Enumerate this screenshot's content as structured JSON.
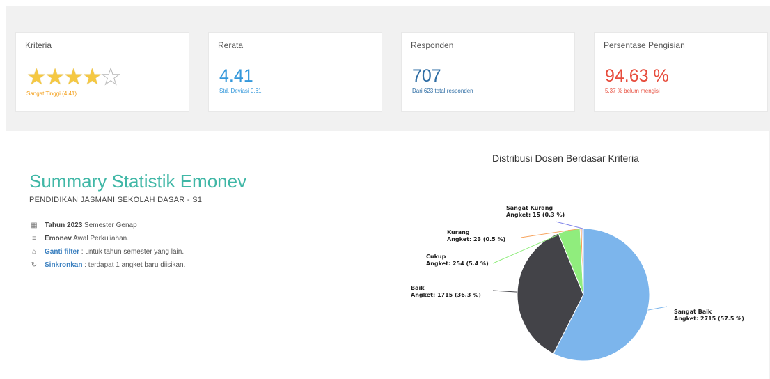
{
  "cards": {
    "kriteria": {
      "title": "Kriteria",
      "rating": 4,
      "rating_max": 5,
      "note": "Sangat Tinggi (4.41)",
      "note_color": "#f39c12"
    },
    "rerata": {
      "title": "Rerata",
      "value": "4.41",
      "note": "Std. Deviasi 0.61",
      "color": "#3498db"
    },
    "responden": {
      "title": "Responden",
      "value": "707",
      "note": "Dari 623 total responden",
      "color": "#2e6da4"
    },
    "persentase": {
      "title": "Persentase Pengisian",
      "value": "94.63 %",
      "note": "5.37 % belum mengisi",
      "color": "#e74c3c"
    }
  },
  "summary": {
    "title": "Summary Statistik Emonev",
    "subtitle": "PENDIDIKAN JASMANI SEKOLAH DASAR - S1",
    "rows": [
      {
        "icon": "calendar-icon",
        "strong": "Tahun 2023",
        "text": " Semester Genap"
      },
      {
        "icon": "list-icon",
        "strong": "Emonev",
        "text": " Awal Perkuliahan."
      },
      {
        "icon": "home-icon",
        "strong": "Ganti filter",
        "text": " : untuk tahun semester yang lain."
      },
      {
        "icon": "refresh-icon",
        "strong": "Sinkronkan",
        "text": " : terdapat 1 angket baru diisikan."
      }
    ]
  },
  "chart_data": {
    "type": "pie",
    "title": "Distribusi Dosen Berdasar Kriteria",
    "slices": [
      {
        "name": "Sangat Baik",
        "value": 2715,
        "percent": 57.5,
        "label": "Angket: 2715 (57.5 %)",
        "color": "#7cb5ec"
      },
      {
        "name": "Baik",
        "value": 1715,
        "percent": 36.3,
        "label": "Angket: 1715 (36.3 %)",
        "color": "#434348"
      },
      {
        "name": "Cukup",
        "value": 254,
        "percent": 5.4,
        "label": "Angket: 254 (5.4 %)",
        "color": "#90ed7d"
      },
      {
        "name": "Kurang",
        "value": 23,
        "percent": 0.5,
        "label": "Angket: 23 (0.5 %)",
        "color": "#f7a35c"
      },
      {
        "name": "Sangat Kurang",
        "value": 15,
        "percent": 0.3,
        "label": "Angket: 15 (0.3 %)",
        "color": "#8085e9"
      }
    ]
  }
}
